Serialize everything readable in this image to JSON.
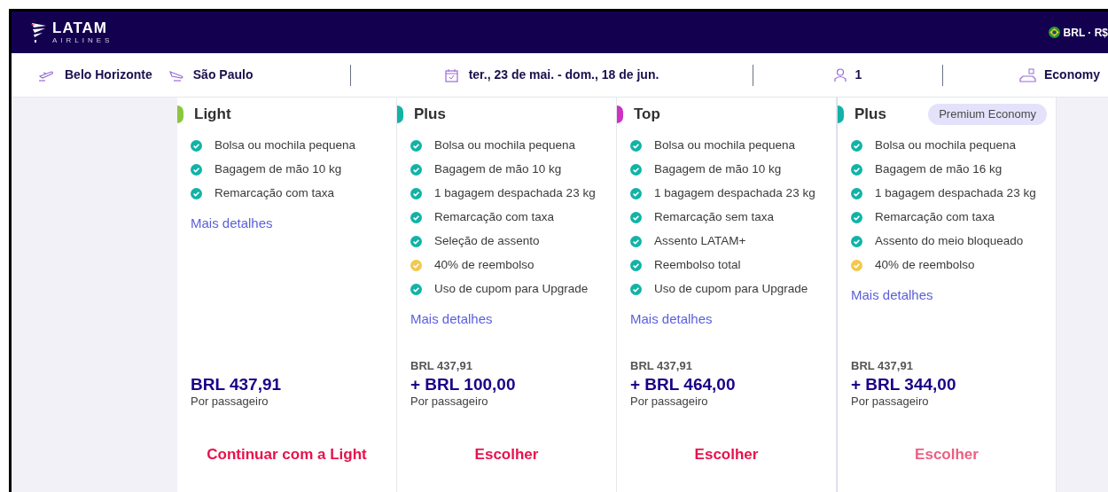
{
  "header": {
    "logo_word": "LATAM",
    "logo_sub": "AIRLINES",
    "currency": "BRL · R$"
  },
  "search": {
    "origin": "Belo Horizonte",
    "destination": "São Paulo",
    "dates": "ter., 23 de mai. - dom., 18 de jun.",
    "passengers": "1",
    "cabin": "Economy"
  },
  "fares": [
    {
      "name": "Light",
      "color": "#8cc63f",
      "features": [
        {
          "text": "Bolsa ou mochila pequena",
          "kind": "included"
        },
        {
          "text": "Bagagem de mão 10 kg",
          "kind": "included"
        },
        {
          "text": "Remarcação com taxa",
          "kind": "included"
        }
      ],
      "details_link": "Mais detalhes",
      "price": "BRL 437,91",
      "per": "Por passageiro",
      "button": "Continuar com a Light",
      "disabled": false
    },
    {
      "name": "Plus",
      "color": "#12b3a7",
      "features": [
        {
          "text": "Bolsa ou mochila pequena",
          "kind": "included"
        },
        {
          "text": "Bagagem de mão 10 kg",
          "kind": "included"
        },
        {
          "text": "1 bagagem despachada 23 kg",
          "kind": "included"
        },
        {
          "text": "Remarcação com taxa",
          "kind": "included"
        },
        {
          "text": "Seleção de assento",
          "kind": "included"
        },
        {
          "text": "40% de reembolso",
          "kind": "partial"
        },
        {
          "text": "Uso de cupom para Upgrade",
          "kind": "included"
        }
      ],
      "details_link": "Mais detalhes",
      "base_price": "BRL 437,91",
      "price": "+ BRL 100,00",
      "per": "Por passageiro",
      "button": "Escolher",
      "disabled": false
    },
    {
      "name": "Top",
      "color": "#cc33c2",
      "features": [
        {
          "text": "Bolsa ou mochila pequena",
          "kind": "included"
        },
        {
          "text": "Bagagem de mão 10 kg",
          "kind": "included"
        },
        {
          "text": "1 bagagem despachada 23 kg",
          "kind": "included"
        },
        {
          "text": "Remarcação sem taxa",
          "kind": "included"
        },
        {
          "text": "Assento LATAM+",
          "kind": "included"
        },
        {
          "text": "Reembolso total",
          "kind": "included"
        },
        {
          "text": "Uso de cupom para Upgrade",
          "kind": "included"
        }
      ],
      "details_link": "Mais detalhes",
      "base_price": "BRL 437,91",
      "price": "+ BRL 464,00",
      "per": "Por passageiro",
      "button": "Escolher",
      "disabled": false
    },
    {
      "name": "Plus",
      "color": "#12b3a7",
      "badge": "Premium Economy",
      "features": [
        {
          "text": "Bolsa ou mochila pequena",
          "kind": "included"
        },
        {
          "text": "Bagagem de mão 16 kg",
          "kind": "included"
        },
        {
          "text": "1 bagagem despachada 23 kg",
          "kind": "included"
        },
        {
          "text": "Remarcação com taxa",
          "kind": "included"
        },
        {
          "text": "Assento do meio bloqueado",
          "kind": "included"
        },
        {
          "text": "40% de reembolso",
          "kind": "partial"
        }
      ],
      "details_link": "Mais detalhes",
      "base_price": "BRL 437,91",
      "price": "+ BRL 344,00",
      "per": "Por passageiro",
      "button": "Escolher",
      "disabled": true
    }
  ]
}
